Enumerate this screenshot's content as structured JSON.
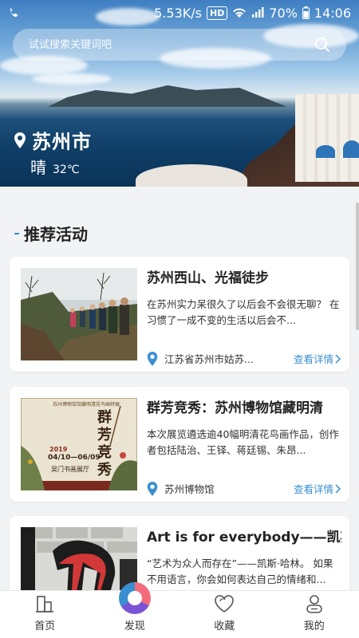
{
  "status_bar": {
    "speed": "5.53K/s",
    "hd": "HD",
    "battery": "70%",
    "time": "14:06",
    "icons": [
      "phone-signal-icon",
      "wifi-icon",
      "cell-signal-icon",
      "battery-icon"
    ]
  },
  "search": {
    "placeholder": "试试搜索关键词吧"
  },
  "location": {
    "city": "苏州市",
    "weather": "晴",
    "temperature": "32℃"
  },
  "section": {
    "title": "推荐活动"
  },
  "activities": [
    {
      "title": "苏州西山、光福徒步",
      "desc": "在苏州实力呆很久了以后会不会很无聊？ 在习惯了一成不变的生活以后会不...",
      "location": "江苏省苏州市姑苏...",
      "more": "查看详情"
    },
    {
      "title": "群芳竞秀：苏州博物馆藏明清",
      "desc": "本次展览遴选逾40幅明清花鸟画作品，创作者包括陆治、王铎、蒋廷锡、朱昂...",
      "location": "苏州博物馆",
      "more": "查看详情",
      "poster": {
        "top": "苏州博物馆馆藏明清花鸟画特展",
        "script": "群芳竞秀",
        "year": "2019",
        "dates": "04/10—06/09",
        "venue": "吴门书画展厅"
      }
    },
    {
      "title": "Art is for everybody——凯斯·",
      "desc": "“艺术为众人而存在”——凯斯·哈林。 如果不用语言，你会如何表达自己的情绪和..."
    }
  ],
  "tabs": [
    {
      "label": "首页",
      "icon": "home-icon"
    },
    {
      "label": "发现",
      "icon": "discover-icon"
    },
    {
      "label": "收藏",
      "icon": "heart-icon"
    },
    {
      "label": "我的",
      "icon": "user-icon"
    }
  ],
  "colors": {
    "accent": "#3a8fd1",
    "page_bg": "#f2f3f5"
  }
}
